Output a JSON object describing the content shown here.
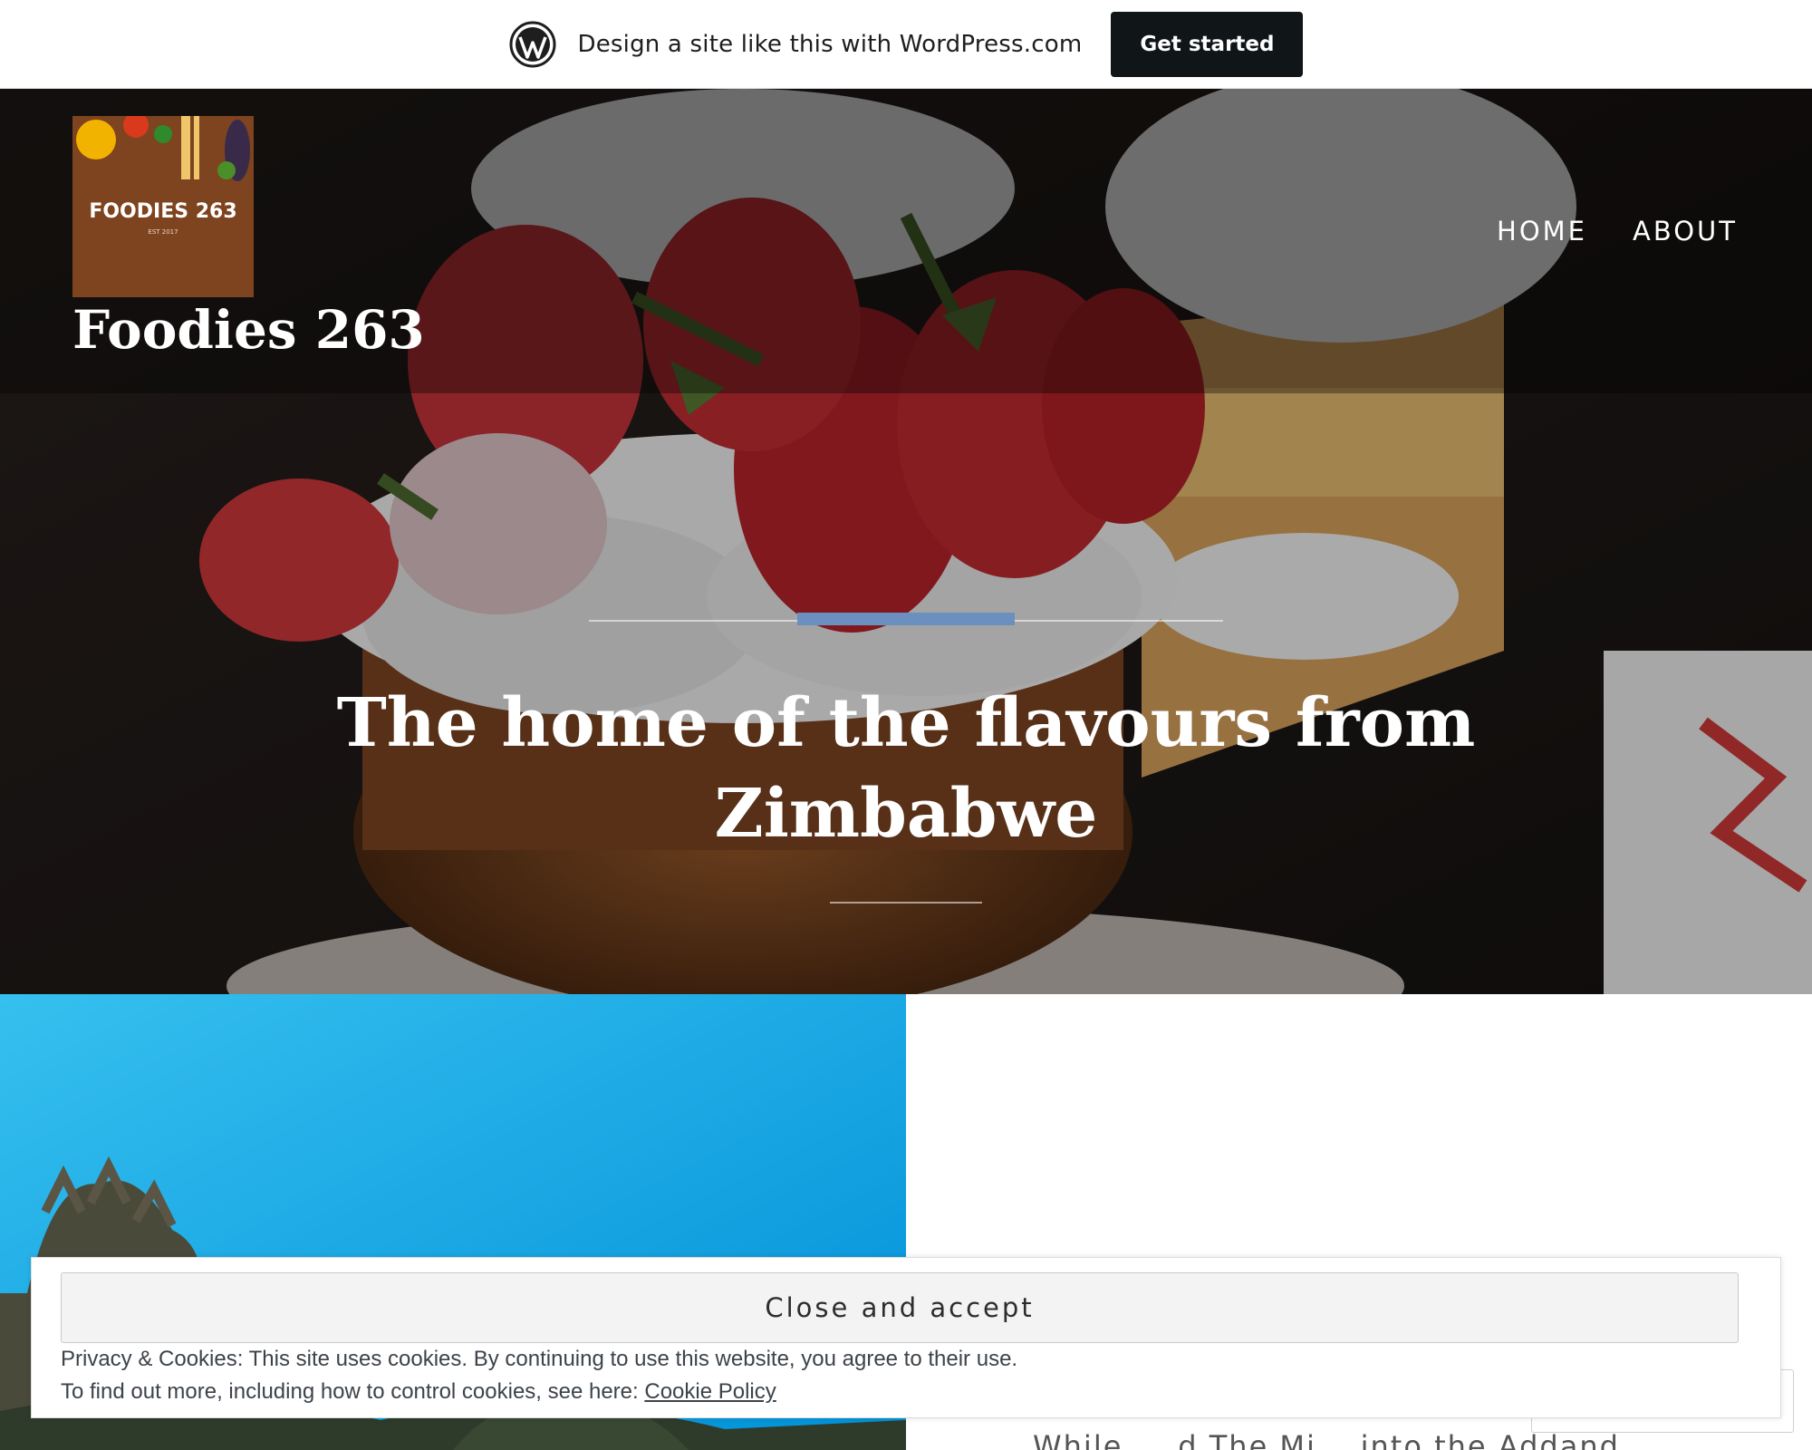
{
  "promo_bar": {
    "icon": "wordpress-logo-icon",
    "text": "Design a site like this with WordPress.com",
    "button_label": "Get started"
  },
  "site": {
    "logo_text": "FOODIES 263",
    "logo_subtext": "EST 2017",
    "title": "Foodies 263"
  },
  "nav": {
    "items": [
      {
        "label": "HOME"
      },
      {
        "label": "ABOUT"
      }
    ]
  },
  "hero": {
    "tagline": "The home of the flavours from Zimbabwe",
    "accent_color": "#6b8fbf"
  },
  "post": {
    "excerpt": "While ... d The Mi... into the Addand..."
  },
  "cookie_banner": {
    "button_label": "Close and accept",
    "line1": "Privacy & Cookies: This site uses cookies. By continuing to use this website, you agree to their use.",
    "line2_prefix": "To find out more, including how to control cookies, see here: ",
    "link_label": "Cookie Policy"
  },
  "colors": {
    "promo_button_bg": "#101517",
    "hero_accent": "#6b8fbf",
    "sky_blue": "#1aa3e0"
  }
}
